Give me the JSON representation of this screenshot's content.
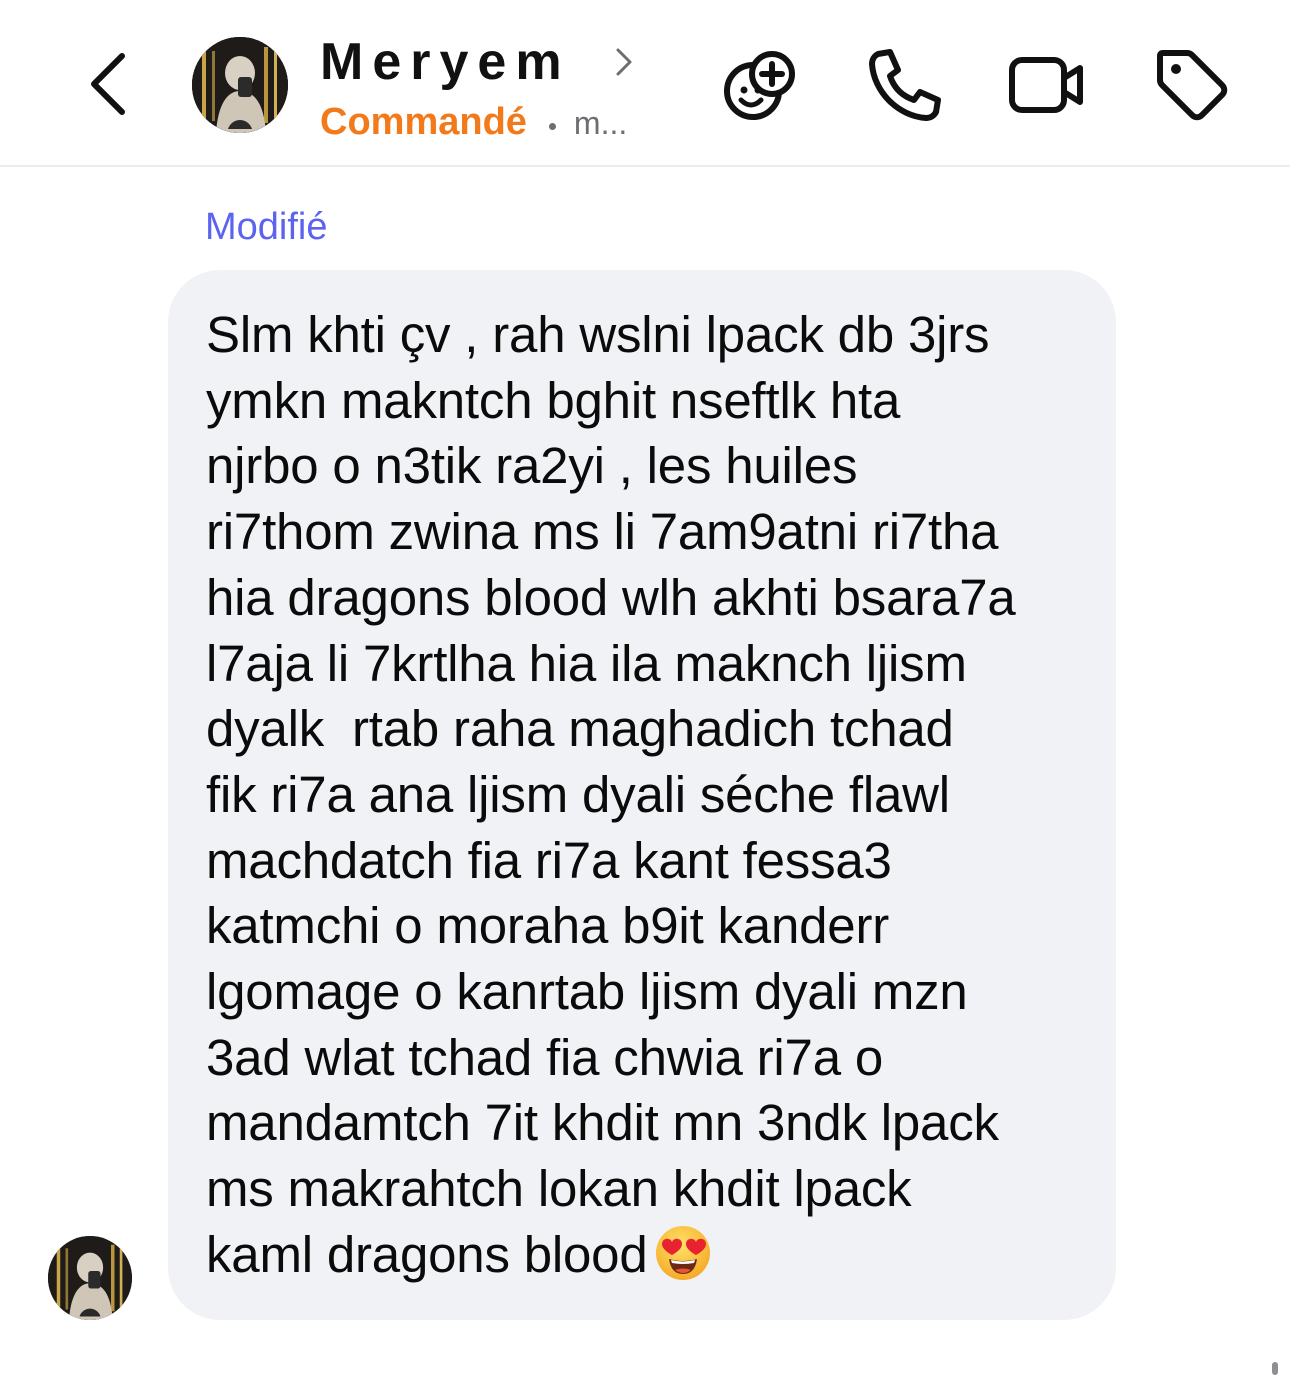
{
  "header": {
    "back_icon": "chevron-left-icon",
    "contact_name": "Meryem",
    "name_chevron_icon": "chevron-right-icon",
    "status_label": "Commandé",
    "status_extra": "m...",
    "actions": [
      {
        "name": "game-invite",
        "icon": "game-controller-plus-icon"
      },
      {
        "name": "audio-call",
        "icon": "phone-icon"
      },
      {
        "name": "video-call",
        "icon": "video-camera-icon"
      },
      {
        "name": "label",
        "icon": "tag-icon"
      }
    ]
  },
  "conversation": {
    "edited_label": "Modifié",
    "message": {
      "text": "Slm khti çv , rah wslni lpack db 3jrs\nymkn makntch bghit nseftlk hta\nnjrbo o n3tik ra2yi , les huiles\nri7thom zwina ms li 7am9atni ri7tha\nhia dragons blood wlh akhti bsara7a\nl7aja li 7krtlha hia ila maknch ljism\ndyalk  rtab raha maghadich tchad\nfik ri7a ana ljism dyali séche flawl\nmachdatch fia ri7a kant fessa3\nkatmchi o moraha b9it kanderr\nlgomage o kanrtab ljism dyali mzn\n3ad wlat tchad fia chwia ri7a o\nmandamtch 7it khdit mn 3ndk lpack\nms makrahtch lokan khdit lpack\nkaml dragons blood",
      "emoji_icon": "heart-eyes-emoji-icon",
      "sender_avatar": "sender-avatar"
    }
  },
  "colors": {
    "status_orange": "#f27a1a",
    "edited_blue": "#5b63f0",
    "bubble_bg": "#f1f2f5",
    "text": "#0b0b0c",
    "muted": "#6d6d72"
  }
}
